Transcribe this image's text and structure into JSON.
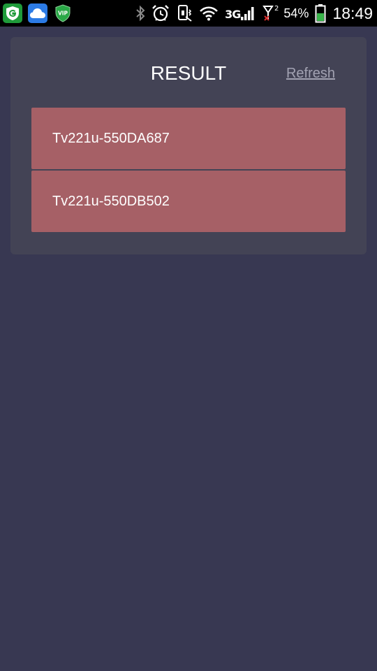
{
  "status_bar": {
    "notification_icons": [
      "g-shield-icon",
      "cloud-icon",
      "vip-shield-icon"
    ],
    "status_icons": [
      "bluetooth-icon",
      "alarm-clock-icon",
      "vibrate-icon",
      "wifi-icon",
      "signal-icon",
      "sim2-no-signal-icon",
      "battery-icon"
    ],
    "network_type": "3G",
    "sim2_label": "2",
    "battery_percent": "54%",
    "battery_level": 0.54,
    "time": "18:49"
  },
  "card": {
    "title": "RESULT",
    "refresh_label": "Refresh"
  },
  "results": [
    {
      "label": "Tv221u-550DA687"
    },
    {
      "label": "Tv221u-550DB502"
    }
  ],
  "colors": {
    "background": "#383852",
    "card": "#434355",
    "item": "#a66066",
    "link": "#a2a2b2"
  }
}
